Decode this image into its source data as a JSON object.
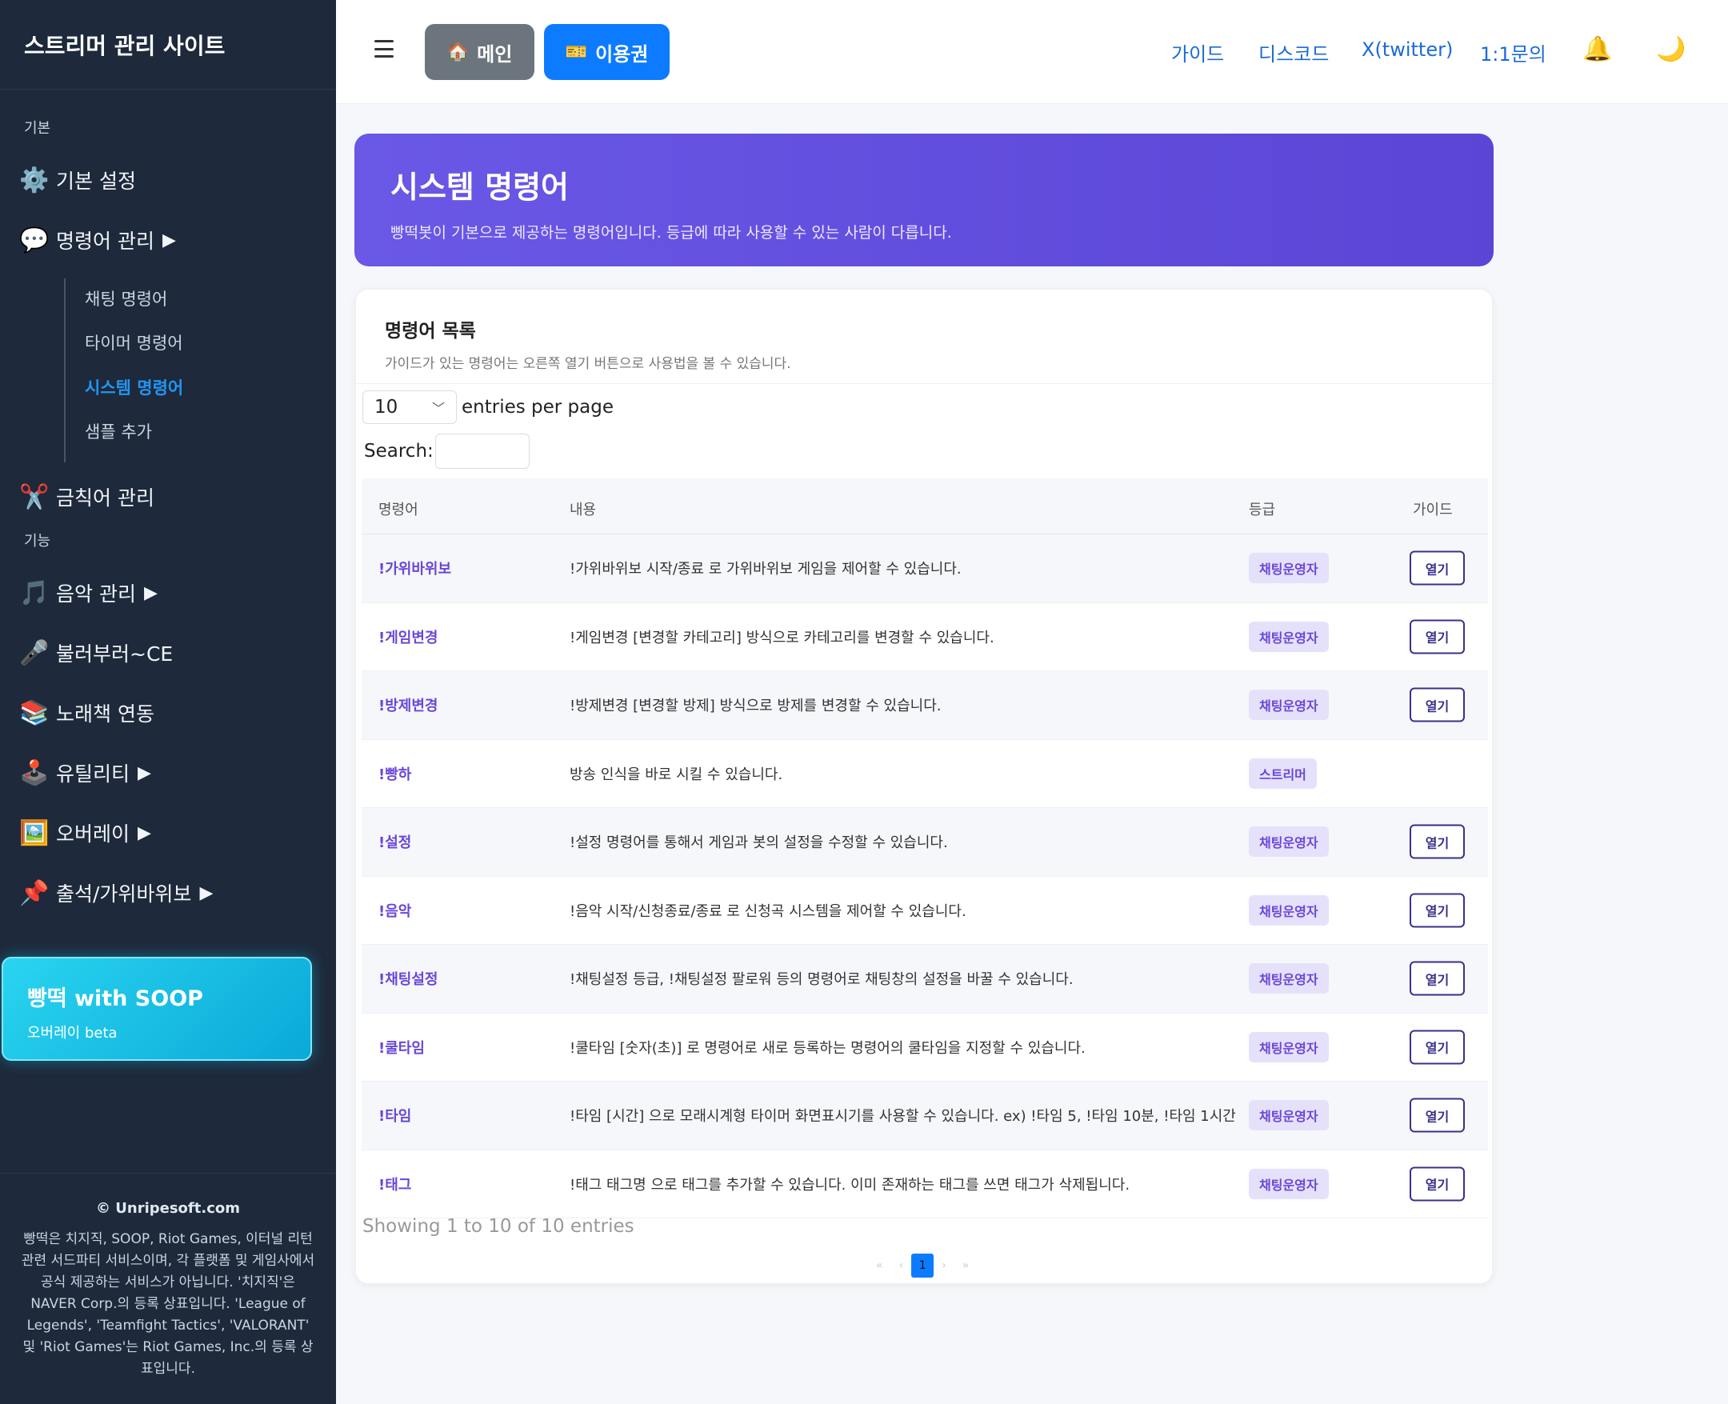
{
  "sidebar": {
    "brand": "스트리머 관리 사이트",
    "section_basic": "기본",
    "basic_settings": {
      "icon": "gear-icon",
      "label": "기본 설정"
    },
    "commands": {
      "icon": "speech-bubble-icon",
      "label": "명령어 관리",
      "arrow": "▶"
    },
    "submenu": [
      "채팅 명령어",
      "타이머 명령어",
      "시스템 명령어",
      "샘플 추가"
    ],
    "active_sub": "시스템 명령어",
    "banned": {
      "icon": "scissors-icon",
      "label": "금칙어 관리"
    },
    "section_features": "기능",
    "music": {
      "icon": "music-note-icon",
      "label": "음악 관리",
      "arrow": "▶"
    },
    "singing": {
      "icon": "microphone-icon",
      "label": "불러부러~CE"
    },
    "songbook": {
      "icon": "books-icon",
      "label": "노래책 연동"
    },
    "utility": {
      "icon": "joystick-icon",
      "label": "유틸리티",
      "arrow": "▶"
    },
    "overlay": {
      "icon": "framed-picture-icon",
      "label": "오버레이",
      "arrow": "▶"
    },
    "attendance": {
      "icon": "pushpin-icon",
      "label": "출석/가위바위보",
      "arrow": "▶"
    },
    "promo": {
      "title": "빵떡 with SOOP",
      "subtitle": "오버레이 beta"
    },
    "footer": {
      "copyright": "© Unripesoft.com",
      "disclaimer": "빵떡은 치지직, SOOP, Riot Games, 이터널 리턴 관련 서드파티 서비스이며, 각 플랫폼 및 게임사에서 공식 제공하는 서비스가 아닙니다. '치지직'은 NAVER Corp.의 등록 상표입니다. 'League of Legends', 'Teamfight Tactics', 'VALORANT' 및 'Riot Games'는 Riot Games, Inc.의 등록 상표입니다."
    }
  },
  "header": {
    "main_button": "메인",
    "ticket_button": "이용권",
    "links": [
      "가이드",
      "디스코드",
      "X(twitter)",
      "1:1문의"
    ],
    "bell_icon": "🔔",
    "moon_icon": "🌙"
  },
  "hero": {
    "title": "시스템 명령어",
    "subtitle": "빵떡봇이 기본으로 제공하는 명령어입니다. 등급에 따라 사용할 수 있는 사람이 다릅니다."
  },
  "card": {
    "title": "명령어 목록",
    "subtitle": "가이드가 있는 명령어는 오른쪽 열기 버튼으로 사용법을 볼 수 있습니다.",
    "per_page_value": "10",
    "per_page_label": "entries per page",
    "search_label": "Search:",
    "search_value": "",
    "columns": [
      "명령어",
      "내용",
      "등급",
      "가이드"
    ],
    "open_label": "열기",
    "rows": [
      {
        "cmd": "!가위바위보",
        "desc": "!가위바위보 시작/종료 로 가위바위보 게임을 제어할 수 있습니다.",
        "grade": "채팅운영자",
        "guide": true
      },
      {
        "cmd": "!게임변경",
        "desc": "!게임변경 [변경할 카테고리] 방식으로 카테고리를 변경할 수 있습니다.",
        "grade": "채팅운영자",
        "guide": true
      },
      {
        "cmd": "!방제변경",
        "desc": "!방제변경 [변경할 방제] 방식으로 방제를 변경할 수 있습니다.",
        "grade": "채팅운영자",
        "guide": true
      },
      {
        "cmd": "!빵하",
        "desc": "방송 인식을 바로 시킬 수 있습니다.",
        "grade": "스트리머",
        "guide": false
      },
      {
        "cmd": "!설정",
        "desc": "!설정 명령어를 통해서 게임과 봇의 설정을 수정할 수 있습니다.",
        "grade": "채팅운영자",
        "guide": true
      },
      {
        "cmd": "!음악",
        "desc": "!음악 시작/신청종료/종료 로 신청곡 시스템을 제어할 수 있습니다.",
        "grade": "채팅운영자",
        "guide": true
      },
      {
        "cmd": "!채팅설정",
        "desc": "!채팅설정 등급, !채팅설정 팔로워 등의 명령어로 채팅창의 설정을 바꿀 수 있습니다.",
        "grade": "채팅운영자",
        "guide": true
      },
      {
        "cmd": "!쿨타임",
        "desc": "!쿨타임 [숫자(초)] 로 명령어로 새로 등록하는 명령어의 쿨타임을 지정할 수 있습니다.",
        "grade": "채팅운영자",
        "guide": true
      },
      {
        "cmd": "!타임",
        "desc": "!타임 [시간] 으로 모래시계형 타이머 화면표시기를 사용할 수 있습니다. ex) !타임 5, !타임 10분, !타임 1시간",
        "grade": "채팅운영자",
        "guide": true
      },
      {
        "cmd": "!태그",
        "desc": "!태그 태그명 으로 태그를 추가할 수 있습니다. 이미 존재하는 태그를 쓰면 태그가 삭제됩니다.",
        "grade": "채팅운영자",
        "guide": true
      }
    ],
    "info": "Showing 1 to 10 of 10 entries",
    "pagination": {
      "first": "«",
      "prev": "‹",
      "current": "1",
      "next": "›",
      "last": "»"
    }
  }
}
